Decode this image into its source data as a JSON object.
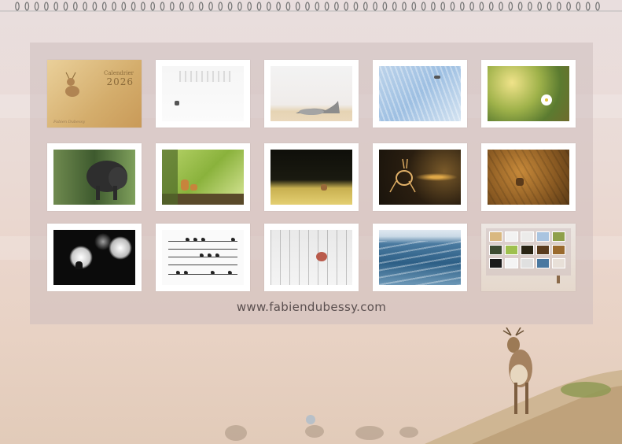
{
  "website": "www.fabiendubessy.com",
  "cover": {
    "title_line": "Calendrier",
    "year": "2026",
    "signature": "Fabien Dubessy"
  },
  "thumbnails": [
    {
      "name": "cover-deer-thumb"
    },
    {
      "name": "snow-hare-thumb"
    },
    {
      "name": "seal-thumb"
    },
    {
      "name": "frost-grass-thumb"
    },
    {
      "name": "daisy-thumb"
    },
    {
      "name": "wild-boar-thumb"
    },
    {
      "name": "fox-cubs-thumb"
    },
    {
      "name": "dark-meadow-thumb"
    },
    {
      "name": "running-hare-thumb"
    },
    {
      "name": "forest-deer-thumb"
    },
    {
      "name": "bird-silhouette-thumb"
    },
    {
      "name": "birds-on-wires-thumb"
    },
    {
      "name": "snowy-forest-thumb"
    },
    {
      "name": "ocean-waves-thumb"
    },
    {
      "name": "back-cover-thumb"
    }
  ],
  "colors": {
    "panel": "#cdbebe",
    "text": "#5a4f4f",
    "accent": "#8a6a3a"
  }
}
